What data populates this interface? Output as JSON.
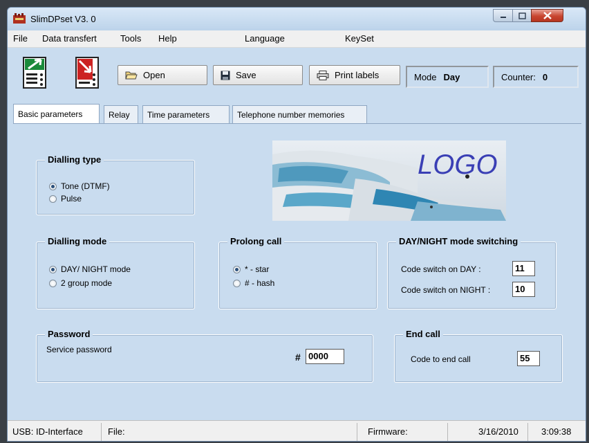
{
  "window": {
    "title": "SlimDPset V3. 0"
  },
  "menu": [
    "File",
    "Data transfert",
    "Tools",
    "Help",
    "Language",
    "KeySet"
  ],
  "toolbar": {
    "open_label": "Open",
    "save_label": "Save",
    "print_label": "Print labels",
    "mode_label": "Mode",
    "mode_value": "Day",
    "counter_label": "Counter:",
    "counter_value": "0"
  },
  "tabs": [
    "Basic parameters",
    "Relay",
    "Time parameters",
    "Telephone number memories"
  ],
  "logo_text": "LOGO",
  "dialling_type": {
    "title": "Dialling type",
    "options": [
      "Tone (DTMF)",
      "Pulse"
    ],
    "selected": "Tone (DTMF)"
  },
  "dialling_mode": {
    "title": "Dialling mode",
    "options": [
      "DAY/ NIGHT mode",
      "2 group mode"
    ],
    "selected": "DAY/ NIGHT mode"
  },
  "prolong_call": {
    "title": "Prolong call",
    "options": [
      "* - star",
      "# - hash"
    ],
    "selected": "* - star"
  },
  "day_night": {
    "title": "DAY/NIGHT mode switching",
    "day_label": "Code switch on DAY :",
    "day_value": "11",
    "night_label": "Code switch on NIGHT :",
    "night_value": "10"
  },
  "password": {
    "title": "Password",
    "label": "Service password",
    "hash": "#",
    "value": "0000"
  },
  "end_call": {
    "title": "End call",
    "label": "Code to end call",
    "value": "55"
  },
  "status": {
    "interface": "USB: ID-Interface",
    "file_label": "File:",
    "firmware_label": "Firmware:",
    "date": "3/16/2010",
    "time": "3:09:38"
  },
  "colors": {
    "window_bg": "#c9dcef",
    "close_button": "#c8452f"
  }
}
